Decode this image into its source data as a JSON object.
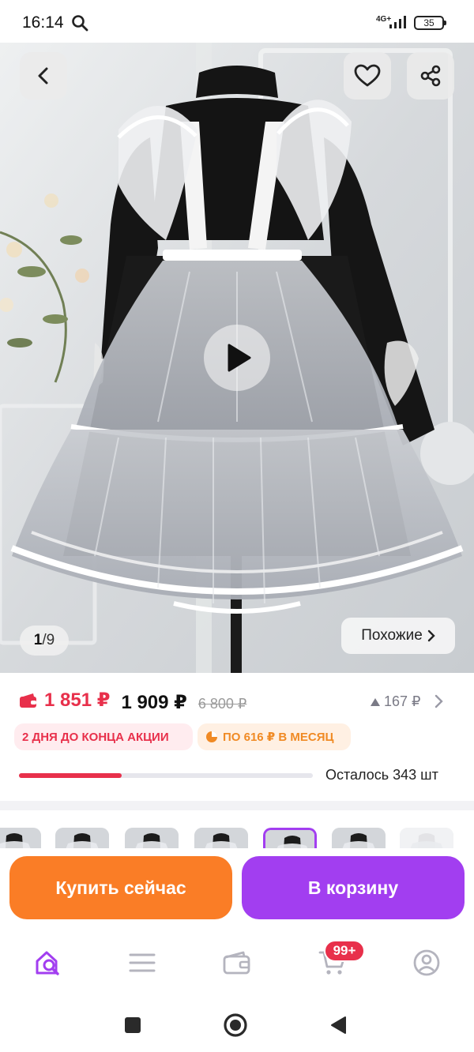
{
  "status_bar": {
    "time": "16:14",
    "network": "4G+",
    "battery": "35",
    "icons": [
      "search-icon",
      "signal-icon",
      "battery-icon"
    ]
  },
  "gallery": {
    "current": "1",
    "separator": "/",
    "total": "9",
    "similar_label": "Похожие",
    "icons": [
      "back-arrow-icon",
      "heart-icon",
      "share-icon",
      "play-icon",
      "chevron-right-icon"
    ]
  },
  "price": {
    "wallet_price": "1 851 ₽",
    "price": "1 909 ₽",
    "old_price": "6 800 ₽",
    "price_delta": "167 ₽",
    "promo_badge": "2 ДНЯ ДО КОНЦА АКЦИИ",
    "installment_badge": "ПО 616 ₽ В МЕСЯЦ",
    "stock_label": "Осталось 343 шт",
    "stock_progress_fraction": 0.35,
    "colors": {
      "accent_red": "#e8304b",
      "accent_orange": "#f08a24"
    }
  },
  "thumbnails": {
    "count": 7,
    "selected_index": 4,
    "selected_color": "#a23ef0"
  },
  "actions": {
    "buy_now_label": "Купить сейчас",
    "add_to_cart_label": "В корзину",
    "colors": {
      "buy_now": "#fa7d26",
      "add_to_cart": "#a23ef0"
    }
  },
  "tabbar": {
    "items": [
      "home-search-icon",
      "catalog-menu-icon",
      "wallet-icon",
      "cart-icon",
      "profile-icon"
    ],
    "cart_badge": "99+",
    "active_color": "#a23ef0"
  },
  "system_nav": {
    "items": [
      "recents-square-icon",
      "home-circle-icon",
      "back-triangle-icon"
    ]
  }
}
